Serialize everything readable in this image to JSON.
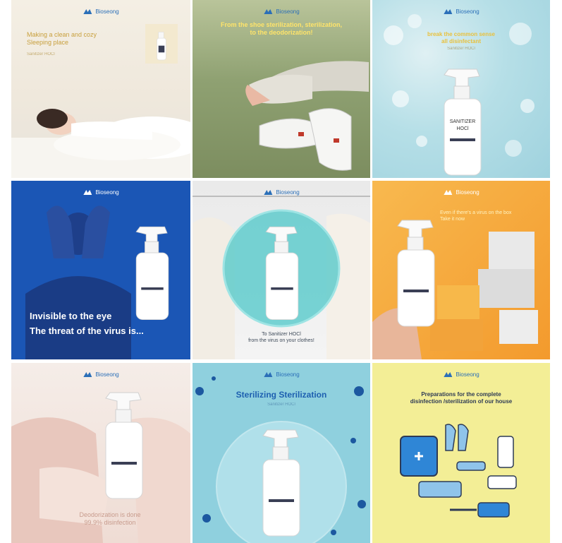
{
  "brand": "Bioseong",
  "tiles": [
    {
      "headline": "Making a clean and cozy\nSleeping place",
      "sub": "Sanitizer HOCl"
    },
    {
      "headline": "From the shoe sterilization, sterilization,\nto the deodorization!"
    },
    {
      "headline": "break the common sense\nall disinfectant",
      "sub": "Sanitizer HOCl"
    },
    {
      "headline": "Invisible to the eye\nThe threat of the virus is..."
    },
    {
      "headline": "To Sanitizer HOCl\nfrom the virus on your clothes!"
    },
    {
      "headline": "Even if there's a virus on the box\nTake it now"
    },
    {
      "headline": "Deodorization is done\n99.9% disinfection"
    },
    {
      "headline": "Sterilizing Sterilization",
      "sub": "Sanitizer HOCl"
    },
    {
      "headline": "Preparations for the complete\ndisinfection /sterilization of our house"
    }
  ],
  "product": {
    "label_main": "SANITIZER",
    "label_sub": "HOCl"
  },
  "colors": {
    "brand_blue": "#2b6fb8",
    "deep_blue": "#1b56b5",
    "orange": "#f6a63a",
    "sky": "#8fd0de",
    "lemon": "#f3ee96"
  }
}
